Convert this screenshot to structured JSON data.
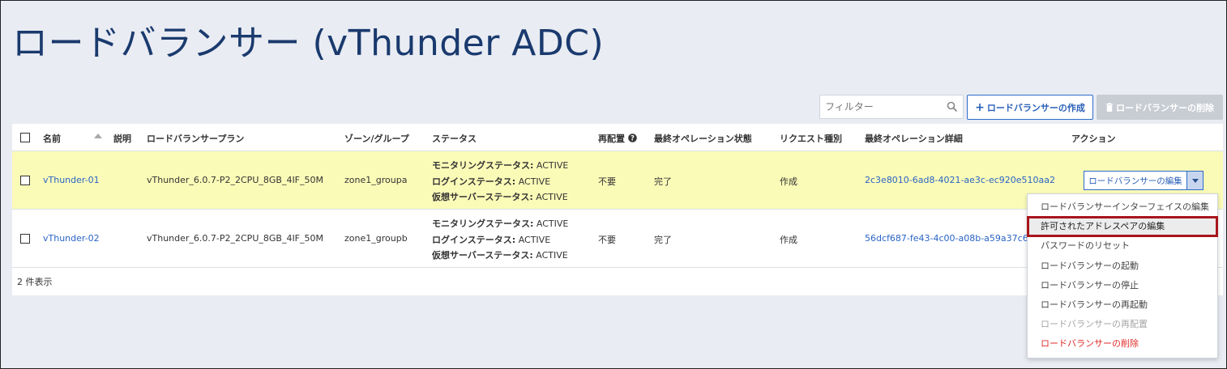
{
  "page": {
    "title": "ロードバランサー (vThunder ADC)"
  },
  "toolbar": {
    "filter_placeholder": "フィルター",
    "create_label": "ロードバランサーの作成",
    "delete_label": "ロードバランサーの削除"
  },
  "table": {
    "headers": {
      "name": "名前",
      "description": "説明",
      "plan": "ロードバランサープラン",
      "zone": "ゾーン/グループ",
      "status": "ステータス",
      "redeploy": "再配置",
      "last_op_state": "最終オペレーション状態",
      "request_type": "リクエスト種別",
      "last_op_detail": "最終オペレーション詳細",
      "action": "アクション"
    },
    "rows": [
      {
        "name": "vThunder-01",
        "plan": "vThunder_6.0.7-P2_2CPU_8GB_4IF_50M",
        "zone": "zone1_groupa",
        "monitoring_label": "モニタリングステータス:",
        "monitoring_value": "ACTIVE",
        "login_label": "ログインステータス:",
        "login_value": "ACTIVE",
        "vserver_label": "仮想サーバーステータス:",
        "vserver_value": "ACTIVE",
        "redeploy": "不要",
        "last_op_state": "完了",
        "request_type": "作成",
        "last_op_detail": "2c3e8010-6ad8-4021-ae3c-ec920e510aa2",
        "action_label": "ロードバランサーの編集"
      },
      {
        "name": "vThunder-02",
        "plan": "vThunder_6.0.7-P2_2CPU_8GB_4IF_50M",
        "zone": "zone1_groupb",
        "monitoring_label": "モニタリングステータス:",
        "monitoring_value": "ACTIVE",
        "login_label": "ログインステータス:",
        "login_value": "ACTIVE",
        "vserver_label": "仮想サーバーステータス:",
        "vserver_value": "ACTIVE",
        "redeploy": "不要",
        "last_op_state": "完了",
        "request_type": "作成",
        "last_op_detail": "56dcf687-fe43-4c00-a08b-a59a37c65957"
      }
    ],
    "count_label": "2 件表示"
  },
  "menu": {
    "items": [
      "ロードバランサーインターフェイスの編集",
      "許可されたアドレスペアの編集",
      "パスワードのリセット",
      "ロードバランサーの起動",
      "ロードバランサーの停止",
      "ロードバランサーの再起動",
      "ロードバランサーの再配置",
      "ロードバランサーの削除"
    ]
  },
  "colors": {
    "accent": "#2a60b8",
    "highlight_row": "#fbfbb8",
    "highlight_border": "#a8151b",
    "danger": "#e02a2a"
  }
}
